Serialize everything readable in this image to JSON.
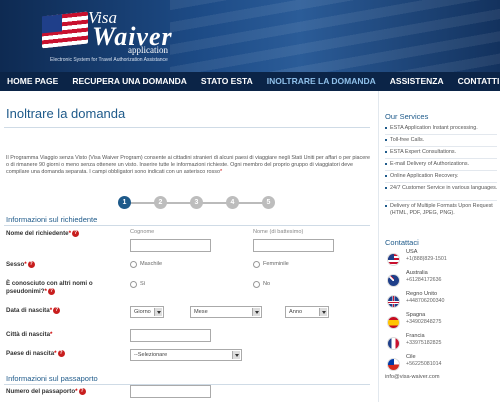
{
  "logo": {
    "line1": "Visa",
    "line2": "Waiver",
    "line3": "application",
    "tagline": "Electronic System for Travel Authorization Assistance"
  },
  "nav": [
    "HOME PAGE",
    "RECUPERA UNA DOMANDA",
    "STATO ESTA",
    "INOLTRARE LA DOMANDA",
    "ASSISTENZA",
    "CONTATTI"
  ],
  "nav_active": 3,
  "page_title": "Inoltrare la domanda",
  "intro": "Il Programma Viaggio senza Visto (Visa Waiver Program) consente ai cittadini stranieri di alcuni paesi di viaggiare negli Stati Uniti per affari o per piacere o di rimanere 90 giorni o meno senza ottenere un visto. Inserire tutte le informazioni richieste. Ogni membro del proprio gruppo di viaggiatori deve compilare una domanda separata. I campi obbligatori sono indicati con un asterisco rosso",
  "steps": [
    "1",
    "2",
    "3",
    "4",
    "5"
  ],
  "section_applicant": "Informazioni sul richiedente",
  "name_label": "Nome del richiedente",
  "surname_sub": "Cognome",
  "firstname_sub": "Nome (di battesimo)",
  "sex_label": "Sesso",
  "male": "Maschile",
  "female": "Femminile",
  "alias_label": "È conosciuto con altri nomi o pseudonimi?",
  "yes": "Sì",
  "no": "No",
  "dob_label": "Data di nascita",
  "day": "Giorno",
  "month": "Mese",
  "year": "Anno",
  "city_label": "Città di nascita",
  "country_label": "Paese di nascita",
  "country_placeholder": "--Selezionare",
  "section_passport": "Informazioni sul passaporto",
  "passport_label": "Numero del passaporto",
  "services_title": "Our Services",
  "services": [
    "ESTA Application Instant processing.",
    "Toll-free Calls.",
    "ESTA Expert Consultations.",
    "E-mail Delivery of Authorizations.",
    "Online Application Recovery.",
    "24/7 Customer Service in various languages.",
    "Delivery of Multiple Formats Upon Request (HTML, PDF, JPEG, PNG)."
  ],
  "contacts_title": "Contattaci",
  "contacts": [
    {
      "country": "USA",
      "phone": "+1(888)829-1501",
      "flag": "usa-flag-icon"
    },
    {
      "country": "Australia",
      "phone": "+61284172636",
      "flag": "australia-flag-icon"
    },
    {
      "country": "Regno Unito",
      "phone": "+448706200340",
      "flag": "uk-flag-icon"
    },
    {
      "country": "Spagna",
      "phone": "+34902848275",
      "flag": "spain-flag-icon"
    },
    {
      "country": "Francia",
      "phone": "+33975182825",
      "flag": "france-flag-icon"
    },
    {
      "country": "Cile",
      "phone": "+56225081014",
      "flag": "chile-flag-icon"
    }
  ],
  "email": "info@visa-waiver.com",
  "colors": {
    "nav": "#0b2447",
    "accent": "#1e5a8a",
    "required": "#c81e1e"
  }
}
